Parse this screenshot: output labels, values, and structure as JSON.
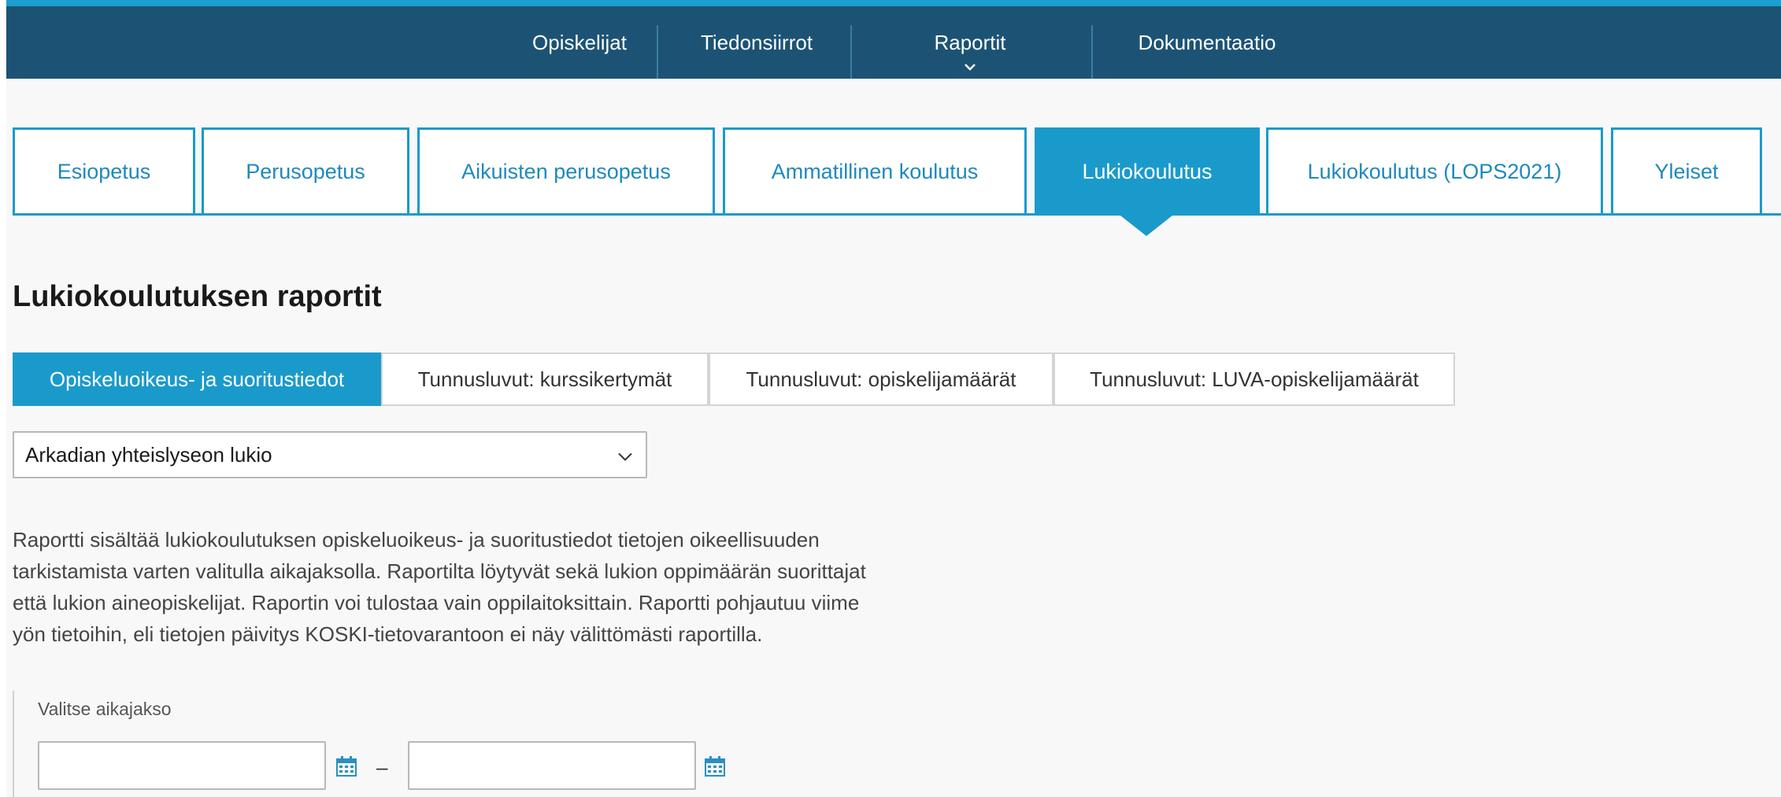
{
  "top_nav": {
    "items": [
      {
        "label": "Opiskelijat"
      },
      {
        "label": "Tiedonsiirrot"
      },
      {
        "label": "Raportit"
      },
      {
        "label": "Dokumentaatio"
      }
    ]
  },
  "education_tabs": [
    {
      "label": "Esiopetus"
    },
    {
      "label": "Perusopetus"
    },
    {
      "label": "Aikuisten perusopetus"
    },
    {
      "label": "Ammatillinen koulutus"
    },
    {
      "label": "Lukiokoulutus",
      "active": true
    },
    {
      "label": "Lukiokoulutus (LOPS2021)"
    },
    {
      "label": "Yleiset"
    }
  ],
  "page_title": "Lukiokoulutuksen raportit",
  "report_tabs": [
    {
      "label": "Opiskeluoikeus- ja suoritustiedot",
      "active": true
    },
    {
      "label": "Tunnusluvut: kurssikertymät"
    },
    {
      "label": "Tunnusluvut: opiskelijamäärät"
    },
    {
      "label": "Tunnusluvut: LUVA-opiskelijamäärät"
    }
  ],
  "organization_select": {
    "value": "Arkadian yhteislyseon lukio"
  },
  "description_lines": [
    "Raportti sisältää lukiokoulutuksen opiskeluoikeus- ja suoritustiedot tietojen oikeellisuuden",
    "tarkistamista varten valitulla aikajaksolla. Raportilta löytyvät sekä lukion oppimäärän suorittajat",
    "että lukion aineopiskelijat. Raportin voi tulostaa vain oppilaitoksittain. Raportti pohjautuu viime",
    "yön tietoihin, eli tietojen päivitys KOSKI-tietovarantoon ei näy välittömästi raportilla."
  ],
  "date_range": {
    "label": "Valitse aikajakso",
    "separator": "–",
    "start_value": "",
    "end_value": ""
  },
  "colors": {
    "nav_bg": "#1c5374",
    "nav_accent": "#1aa0cf",
    "tab_blue": "#1a9acb",
    "tab_text": "#1f89bd",
    "page_bg": "#f8f8f8",
    "calendar_icon": "#2a8fc0"
  },
  "icons": {
    "raportit_dropdown": "chevron-down-icon",
    "select_arrow": "chevron-down-icon",
    "date_picker": "calendar-icon"
  }
}
